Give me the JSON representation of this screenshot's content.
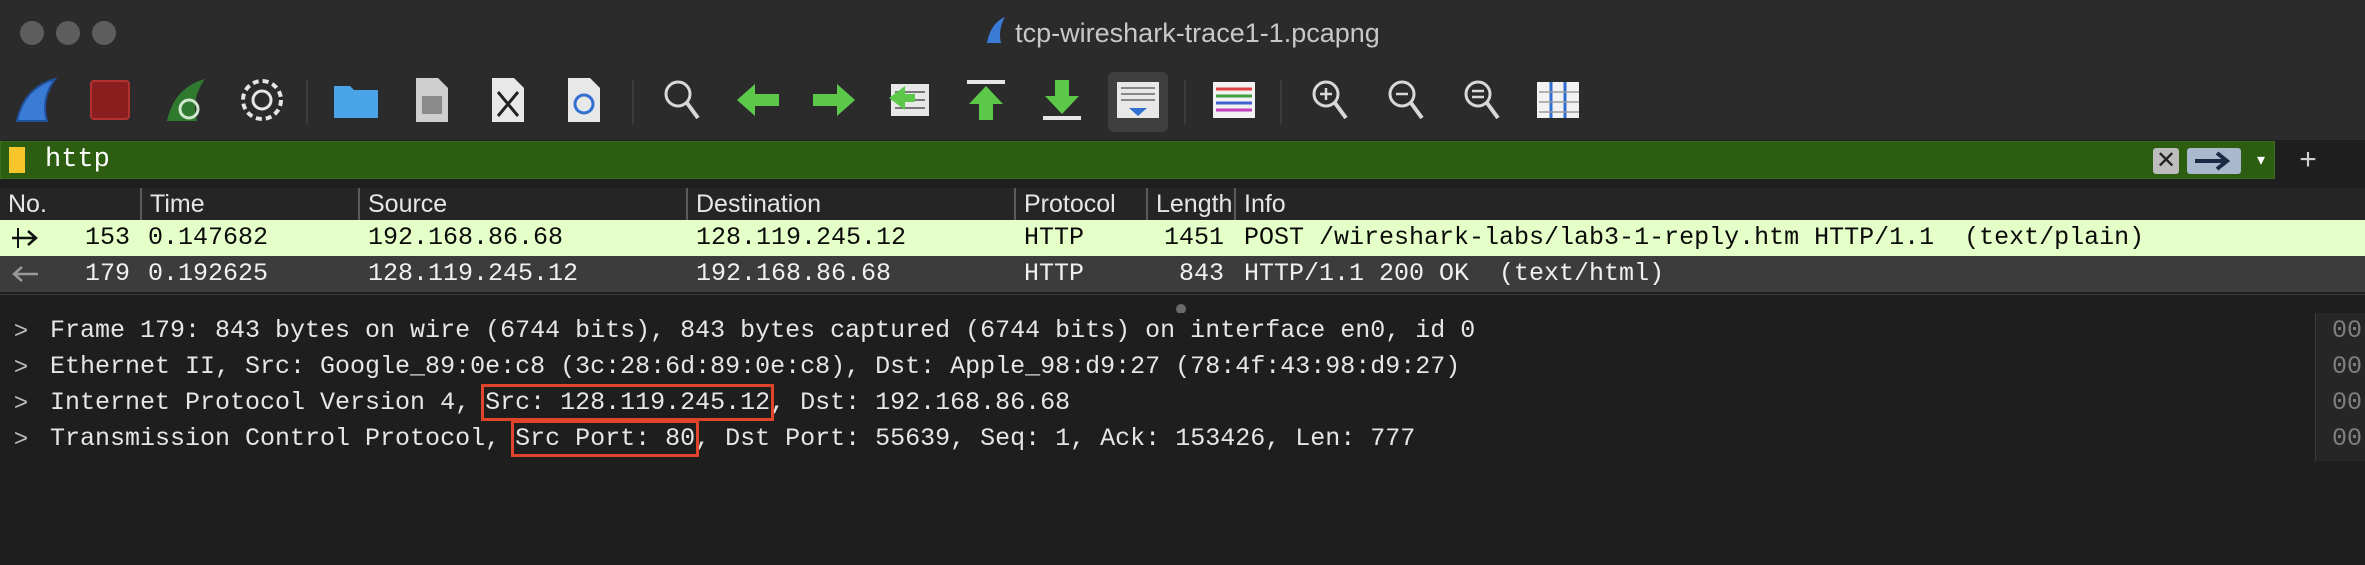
{
  "window": {
    "title": "tcp-wireshark-trace1-1.pcapng"
  },
  "toolbar": {
    "buttons": [
      "start-capture",
      "stop-capture",
      "restart-capture",
      "capture-options",
      "open-file",
      "save-file",
      "close-file",
      "reload-file",
      "find-packet",
      "go-back",
      "go-forward",
      "go-to-packet",
      "go-first",
      "go-last",
      "auto-scroll",
      "colorize",
      "zoom-in",
      "zoom-out",
      "zoom-normal",
      "resize-columns"
    ]
  },
  "filter": {
    "value": "http",
    "clear_glyph": "✕",
    "add_glyph": "+",
    "dropdown_glyph": "▾"
  },
  "columns": [
    "No.",
    "Time",
    "Source",
    "Destination",
    "Protocol",
    "Length",
    "Info"
  ],
  "packets": [
    {
      "no": "153",
      "time": "0.147682",
      "source": "192.168.86.68",
      "destination": "128.119.245.12",
      "protocol": "HTTP",
      "length": "1451",
      "info": "POST /wireshark-labs/lab3-1-reply.htm HTTP/1.1  (text/plain)"
    },
    {
      "no": "179",
      "time": "0.192625",
      "source": "128.119.245.12",
      "destination": "192.168.86.68",
      "protocol": "HTTP",
      "length": "843",
      "info": "HTTP/1.1 200 OK  (text/html)"
    }
  ],
  "details": {
    "arrow": ">",
    "frame": "Frame 179: 843 bytes on wire (6744 bits), 843 bytes captured (6744 bits) on interface en0, id 0",
    "ethernet": "Ethernet II, Src: Google_89:0e:c8 (3c:28:6d:89:0e:c8), Dst: Apple_98:d9:27 (78:4f:43:98:d9:27)",
    "ip_prefix": "Internet Protocol Version 4, ",
    "ip_src": "Src: 128.119.245.12",
    "ip_suffix": ", Dst: 192.168.86.68",
    "tcp_prefix": "Transmission Control Protocol, ",
    "tcp_src": "Src Port: 80",
    "tcp_suffix": ", Dst Port: 55639, Seq: 1, Ack: 153426, Len: 777"
  },
  "bytes_pane": [
    "00",
    "00",
    "00",
    "00"
  ],
  "colors": {
    "filter_valid": "#2d5d10",
    "row_http": "#e4ffc7",
    "row_selected": "#3c3c3c",
    "highlight_box": "#e0442a"
  }
}
